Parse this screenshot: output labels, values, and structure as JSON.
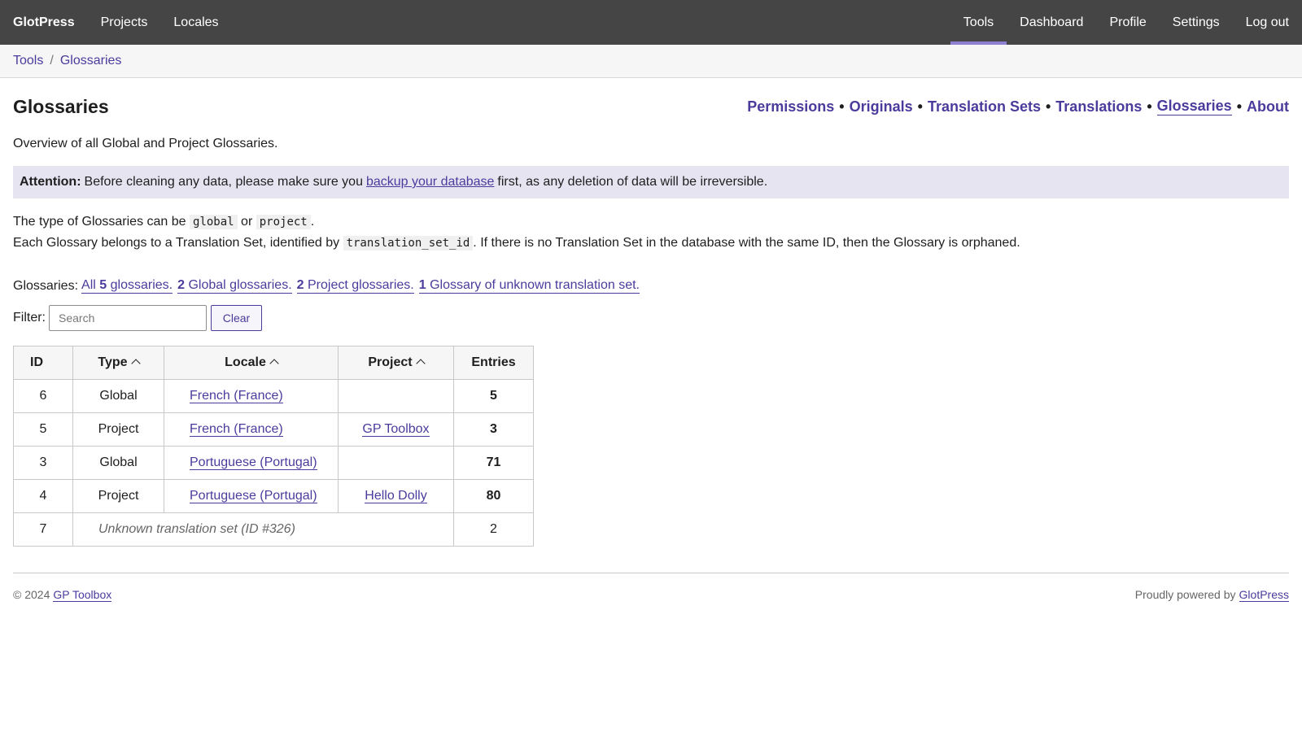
{
  "topbar": {
    "brand": "GlotPress",
    "left": [
      "Projects",
      "Locales"
    ],
    "right": [
      "Tools",
      "Dashboard",
      "Profile",
      "Settings",
      "Log out"
    ],
    "active": "Tools",
    "active_color": "#8f7fd1"
  },
  "breadcrumb": {
    "items": [
      "Tools",
      "Glossaries"
    ],
    "separator": "/"
  },
  "page": {
    "title": "Glossaries",
    "tools_nav": [
      "Permissions",
      "Originals",
      "Translation Sets",
      "Translations",
      "Glossaries",
      "About"
    ],
    "current_tool": "Glossaries",
    "description": "Overview of all Global and Project Glossaries.",
    "attention": {
      "label": "Attention:",
      "before": "Before cleaning any data, please make sure you",
      "link": "backup your database",
      "after": "first, as any deletion of data will be irreversible."
    },
    "types_line": {
      "prefix": "The type of Glossaries can be",
      "code1": "global",
      "mid": "or",
      "code2": "project",
      "suffix": "."
    },
    "belongs_line": {
      "prefix": "Each Glossary belongs to a Translation Set, identified by",
      "code": "translation_set_id",
      "suffix": ". If there is no Translation Set in the database with the same ID, then the Glossary is orphaned."
    },
    "summary": {
      "label": "Glossaries:",
      "all_pre": "All",
      "all_count": "5",
      "all_post": "glossaries.",
      "global_count": "2",
      "global_text": "Global glossaries.",
      "project_count": "2",
      "project_text": "Project glossaries.",
      "unknown_count": "1",
      "unknown_text": "Glossary of unknown translation set."
    },
    "filter": {
      "label": "Filter:",
      "placeholder": "Search",
      "value": "",
      "clear": "Clear"
    }
  },
  "table": {
    "headers": [
      "ID",
      "Type",
      "Locale",
      "Project",
      "Entries"
    ],
    "rows": [
      {
        "id": "6",
        "type": "Global",
        "locale": "French (France)",
        "project": "",
        "entries": "5"
      },
      {
        "id": "5",
        "type": "Project",
        "locale": "French (France)",
        "project": "GP Toolbox",
        "entries": "3"
      },
      {
        "id": "3",
        "type": "Global",
        "locale": "Portuguese (Portugal)",
        "project": "",
        "entries": "71"
      },
      {
        "id": "4",
        "type": "Project",
        "locale": "Portuguese (Portugal)",
        "project": "Hello Dolly",
        "entries": "80"
      }
    ],
    "unknown_row": {
      "id": "7",
      "text": "Unknown translation set (ID #326)",
      "entries": "2"
    }
  },
  "footer": {
    "copyright": "© 2024",
    "copyright_link": "GP Toolbox",
    "powered": "Proudly powered by",
    "powered_link": "GlotPress"
  },
  "colors": {
    "accent": "#4b3b9c",
    "topbar": "#454545",
    "notice_bg": "#e7e4f2"
  }
}
